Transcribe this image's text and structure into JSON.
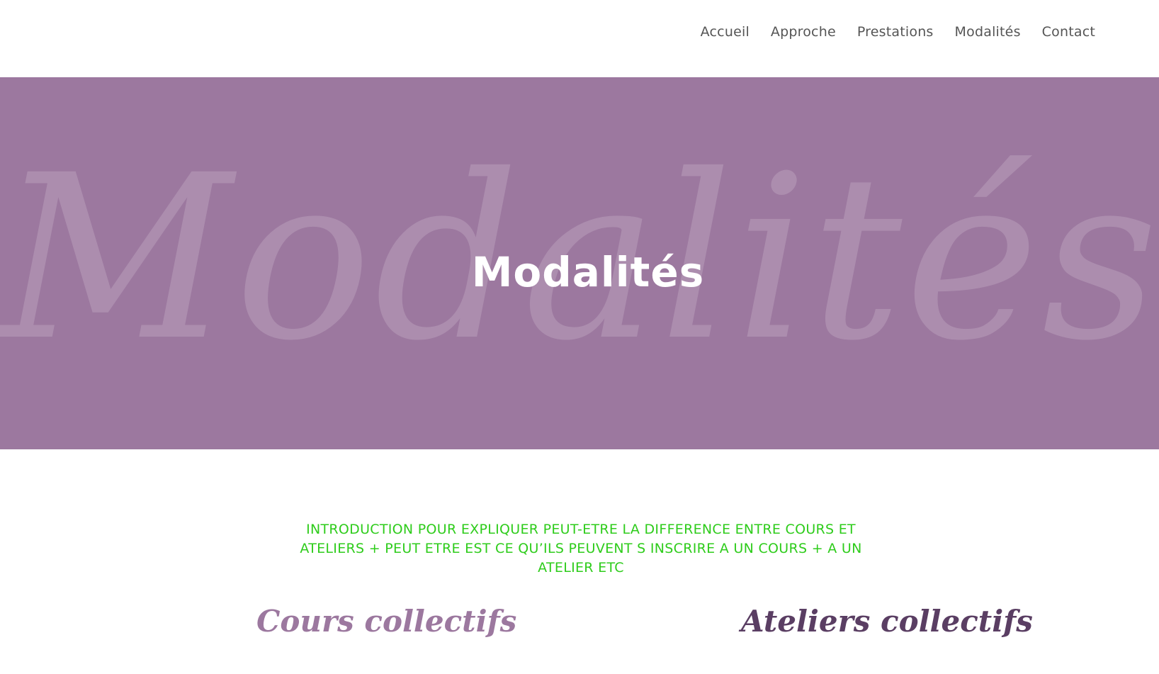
{
  "nav": {
    "items": [
      {
        "label": "Accueil"
      },
      {
        "label": "Approche"
      },
      {
        "label": "Prestations"
      },
      {
        "label": "Modalités"
      },
      {
        "label": "Contact"
      }
    ]
  },
  "hero": {
    "watermark": "Modalités",
    "title": "Modalités",
    "background_color": "#9c789f"
  },
  "intro": {
    "text": "INTRODUCTION POUR EXPLIQUER  PEUT-ETRE LA DIFFERENCE ENTRE COURS ET ATELIERS + PEUT ETRE EST CE QU’ILS PEUVENT S INSCRIRE A UN COURS + A UN ATELIER ETC",
    "color": "#2ecc1b"
  },
  "sections": {
    "left_title": "Cours collectifs",
    "right_title": "Ateliers collectifs"
  }
}
